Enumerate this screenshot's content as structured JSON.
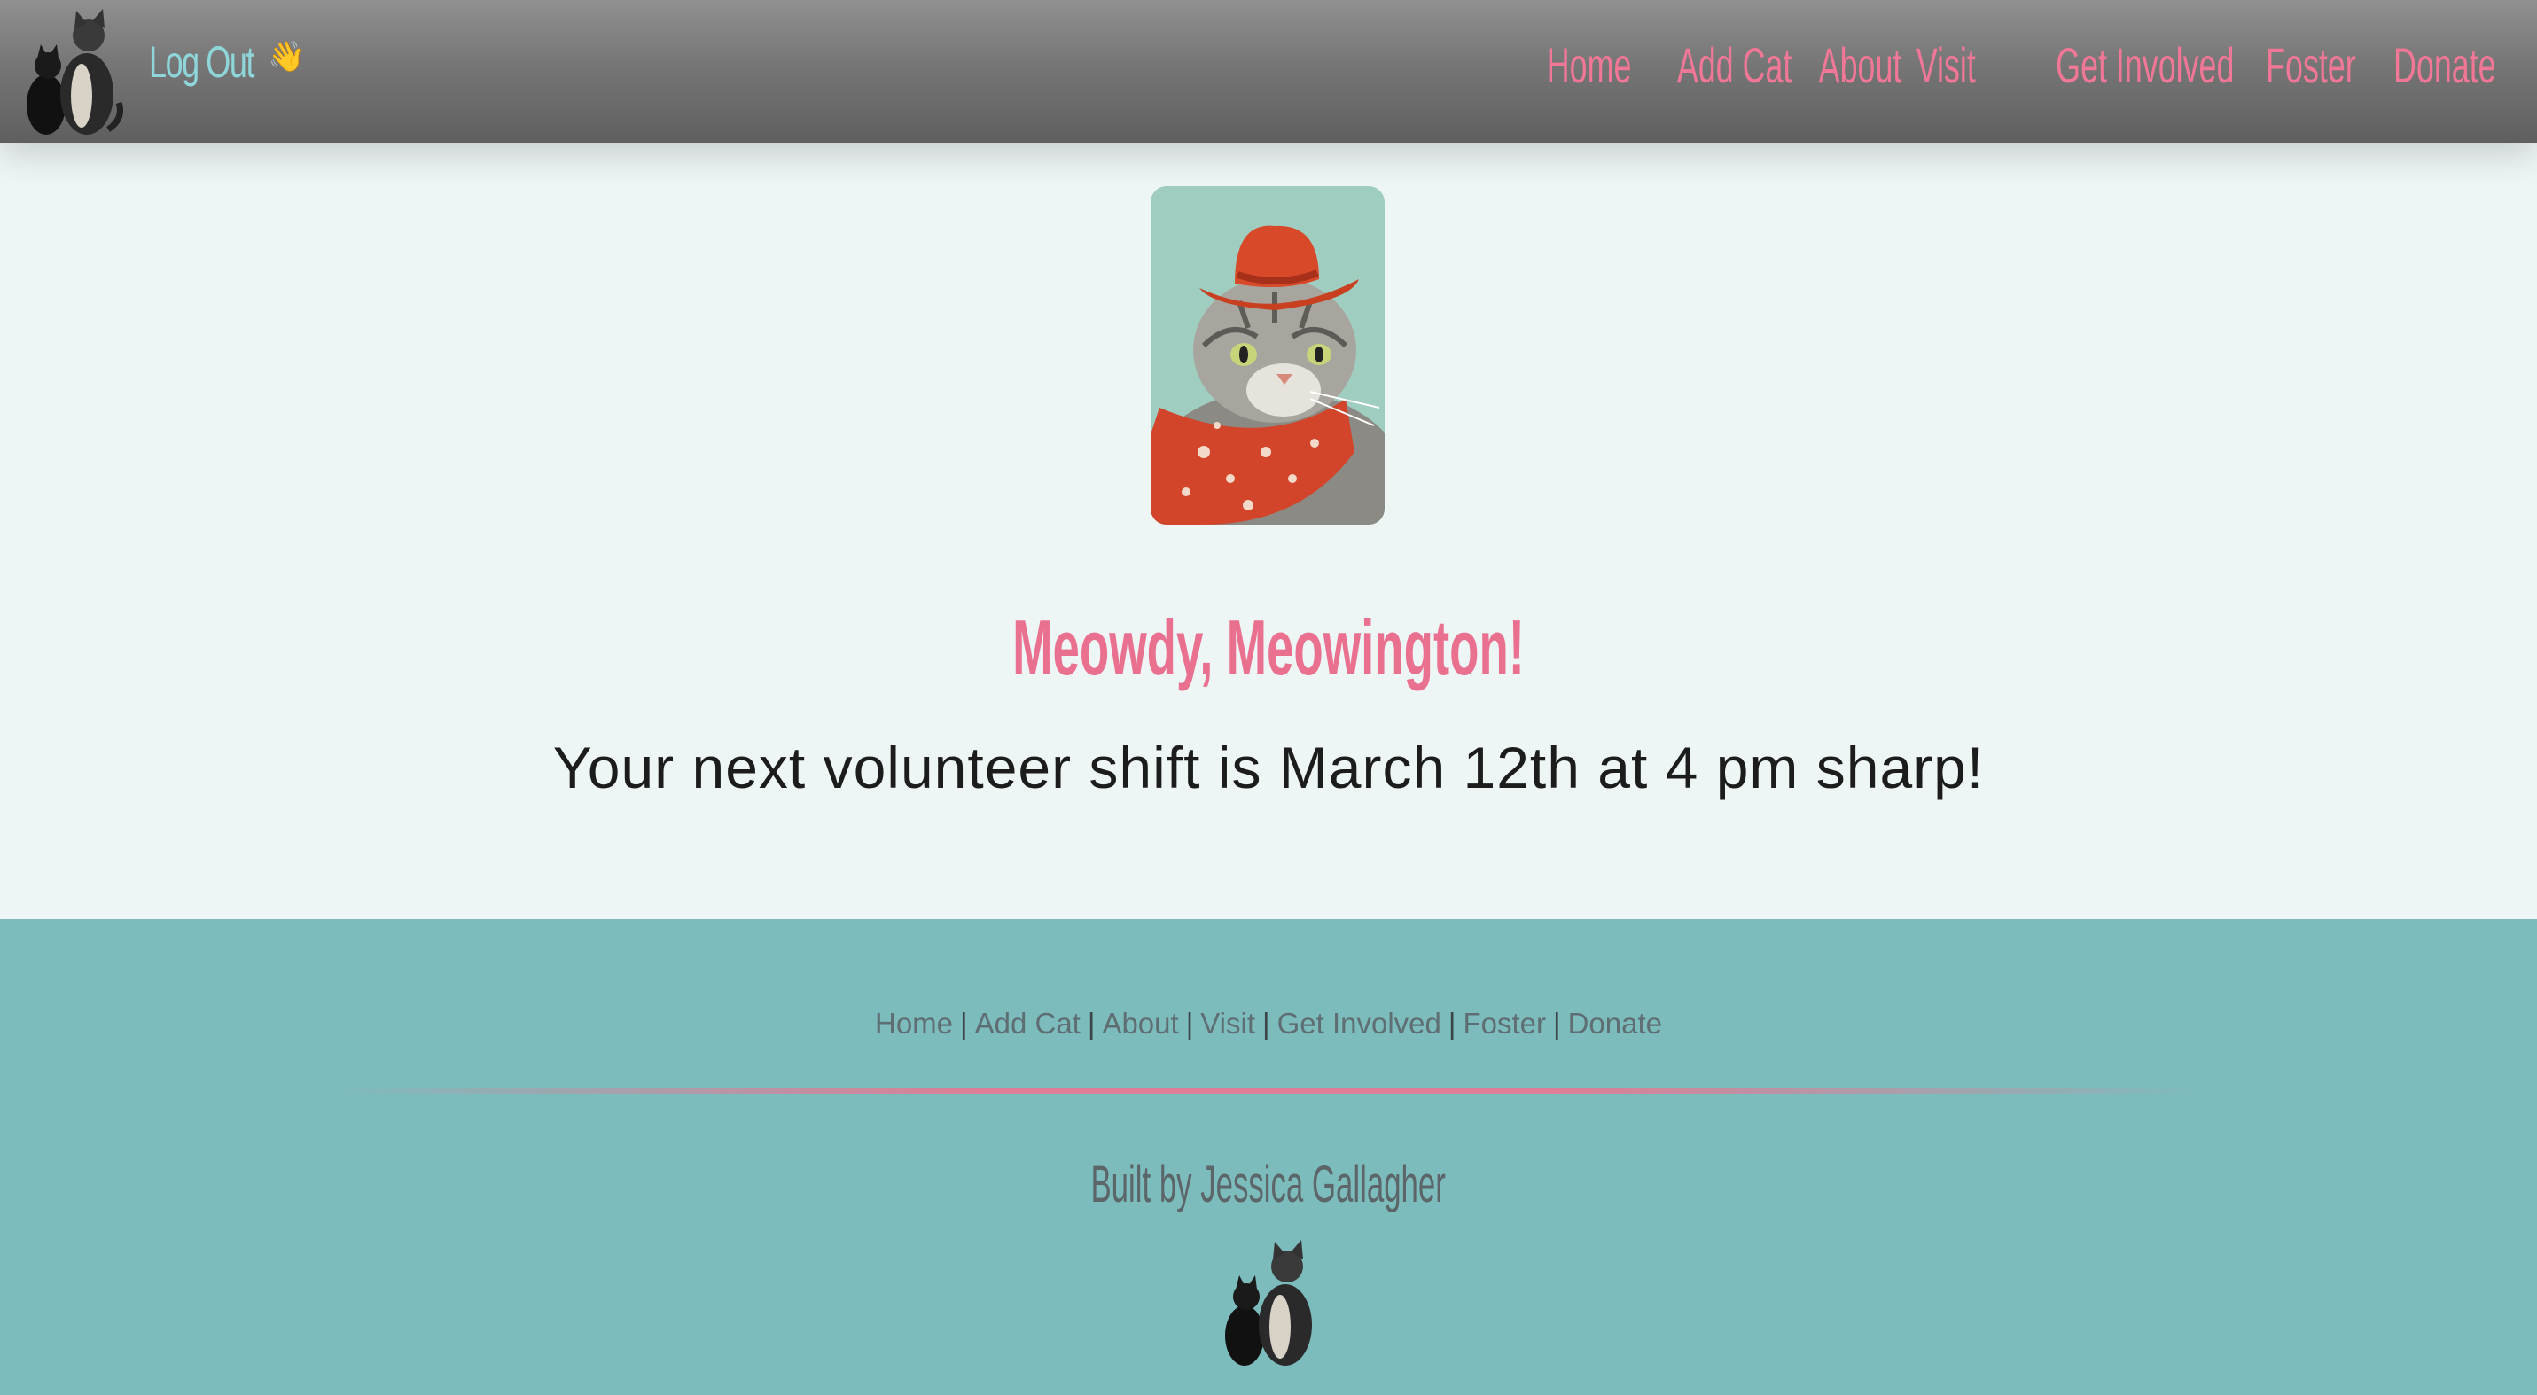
{
  "header": {
    "logout_label": "Log Out",
    "wave_emoji": "👋",
    "nav": [
      {
        "label": "Home"
      },
      {
        "label": "Add Cat"
      },
      {
        "label": "About"
      },
      {
        "label": "Visit"
      },
      {
        "label": "Get Involved"
      },
      {
        "label": "Foster"
      },
      {
        "label": "Donate"
      }
    ]
  },
  "main": {
    "greeting": "Meowdy, Meowington!",
    "shift_message": "Your next volunteer shift is March 12th at 4 pm sharp!"
  },
  "footer": {
    "links": [
      {
        "label": "Home"
      },
      {
        "label": "Add Cat"
      },
      {
        "label": "About"
      },
      {
        "label": "Visit"
      },
      {
        "label": "Get Involved"
      },
      {
        "label": "Foster"
      },
      {
        "label": "Donate"
      }
    ],
    "separator": "|",
    "credit": "Built by Jessica Gallagher"
  },
  "colors": {
    "nav_pink": "#f07796",
    "logout_teal": "#8ed6da",
    "footer_bg": "#7dbcbd",
    "page_bg": "#eef5f5"
  }
}
